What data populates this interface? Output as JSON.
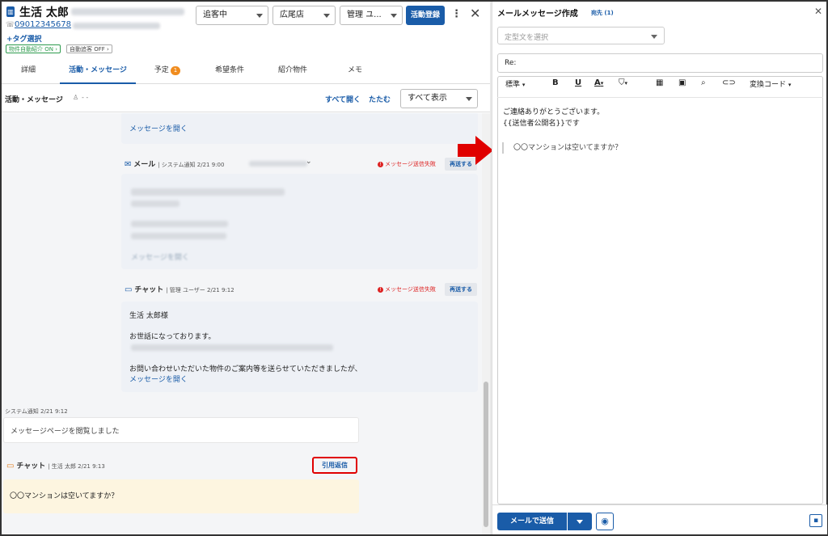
{
  "header": {
    "customer_name": "生活 太郎",
    "phone": "09012345678",
    "tag_link": "+タグ選択",
    "badge_auto_intro": "物件自動紹介 ON",
    "badge_auto_follow": "自動追客 OFF",
    "status_select": "追客中",
    "store_select": "広尾店",
    "manager_select": "管理 ユ...",
    "register_button": "活動登録"
  },
  "tabs": [
    {
      "label": "詳細"
    },
    {
      "label": "活動・メッセージ"
    },
    {
      "label": "予定",
      "count": "1"
    },
    {
      "label": "希望条件"
    },
    {
      "label": "紹介物件"
    },
    {
      "label": "メモ"
    }
  ],
  "subheader": {
    "title": "活動・メッセージ",
    "person_text": "- -",
    "expand_all": "すべて開く",
    "collapse": "たたむ",
    "filter_select": "すべて表示"
  },
  "timeline": {
    "open_message_1": "メッセージを開く",
    "mail": {
      "type": "メール",
      "meta": "システム通知 2/21 9:00",
      "error": "メッセージ送信失敗",
      "resend": "再送する",
      "open_link": "メッセージを開く"
    },
    "chat1": {
      "type": "チャット",
      "meta": "管理 ユーザー 2/21 9:12",
      "error": "メッセージ送信失敗",
      "resend": "再送する",
      "line1": "生活 太郎様",
      "line2": "お世話になっております。",
      "line3": "お問い合わせいただいた物件のご案内等を送らせていただきましたが、",
      "open_link": "メッセージを開く"
    },
    "system": {
      "meta": "システム通知 2/21 9:12",
      "text": "メッセージページを閲覧しました"
    },
    "chat2": {
      "type": "チャット",
      "meta": "生活 太郎 2/21 9:13",
      "quote_reply": "引用返信",
      "text": "〇〇マンションは空いてますか？"
    }
  },
  "compose": {
    "title": "メールメッセージ作成",
    "recipients": "宛先 (1)",
    "template_placeholder": "定型文を選択",
    "subject": "Re:",
    "toolbar": {
      "style": "標準",
      "bold": "B",
      "underline": "U",
      "font_color": "A",
      "convert_code": "変換コード"
    },
    "body_line1": "ご連絡ありがとうございます。",
    "body_line2": "{{送信者公開名}}です",
    "quoted": "〇〇マンションは空いてますか？",
    "send_button": "メールで送信"
  },
  "colors": {
    "accent": "#1a5ca8",
    "error": "#dd2222",
    "highlight_box": "#e00000",
    "quoted_bg": "#fdf5e0"
  }
}
